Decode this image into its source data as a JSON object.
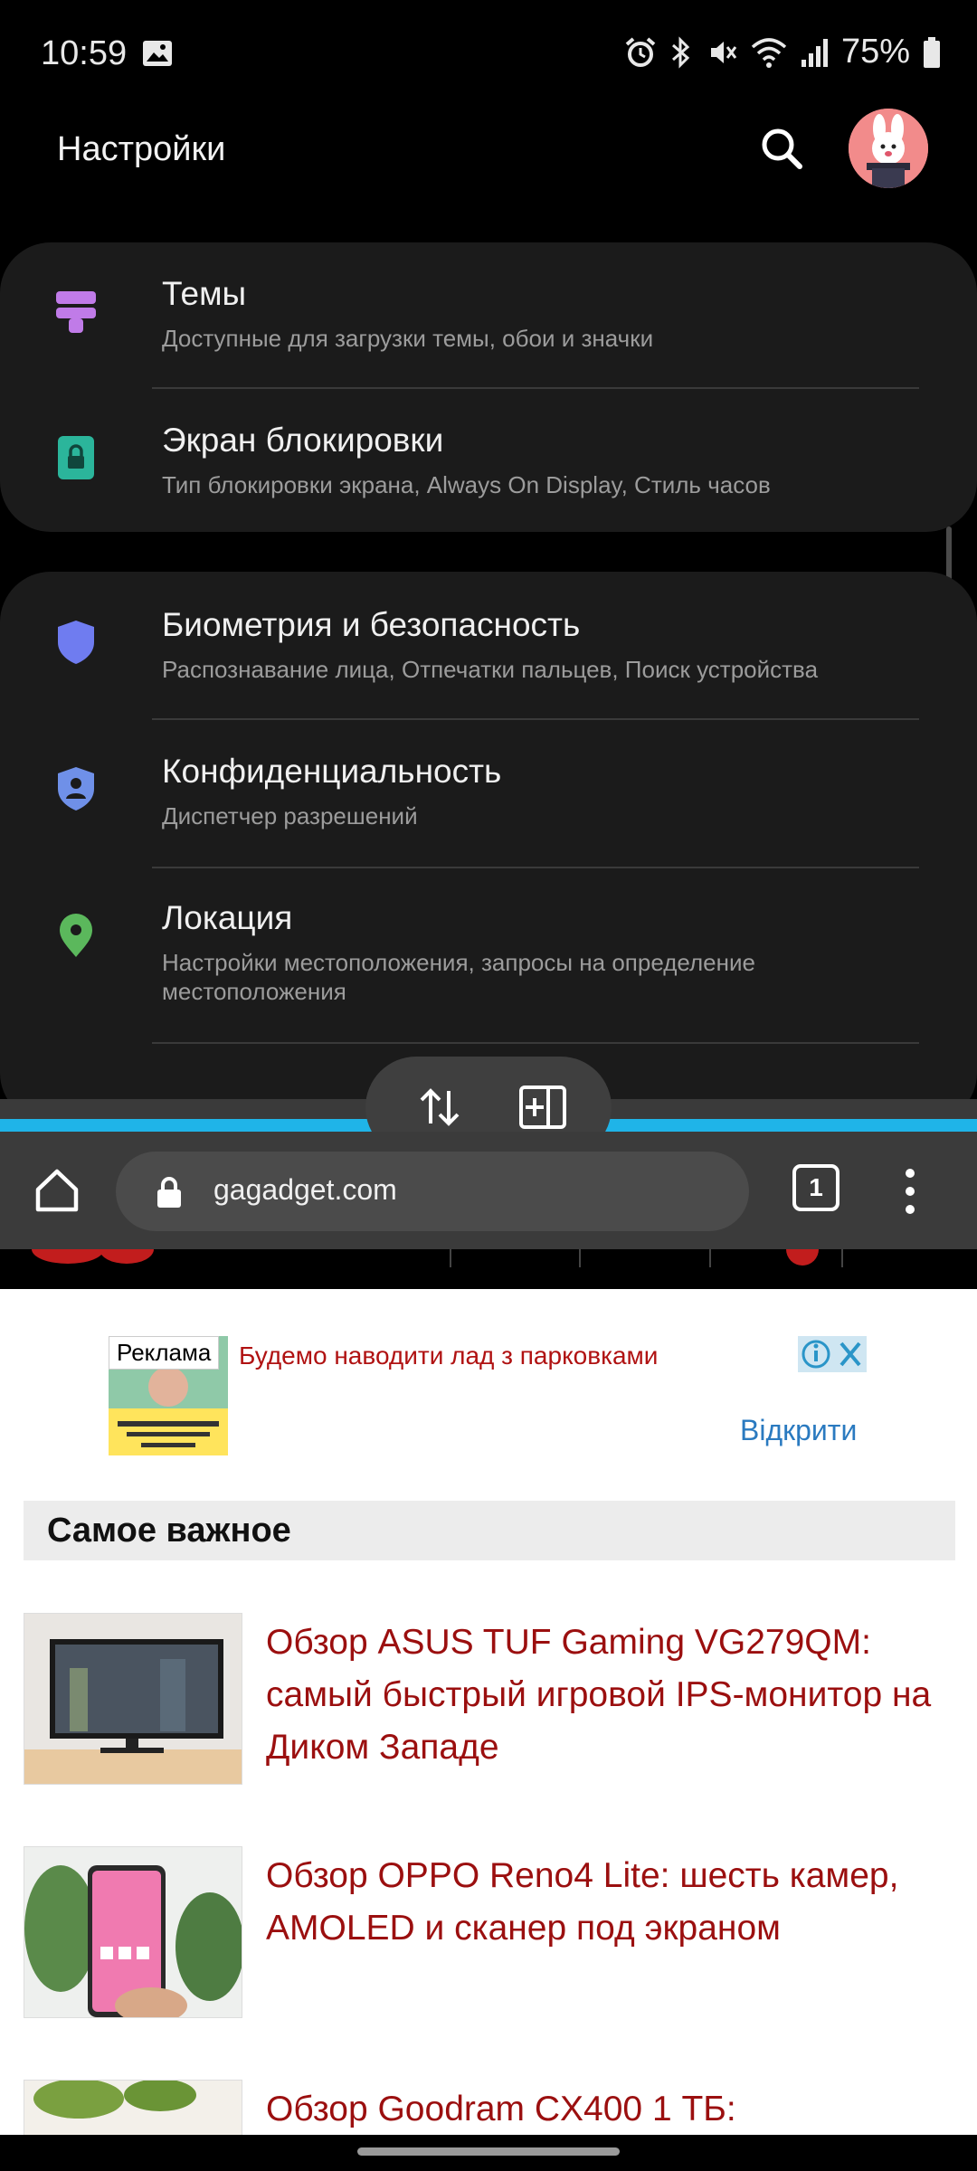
{
  "status_bar": {
    "time": "10:59",
    "battery": "75%",
    "icons": [
      "image-icon",
      "alarm-icon",
      "bluetooth-icon",
      "mute-icon",
      "wifi-icon",
      "signal-icon",
      "battery-icon"
    ]
  },
  "settings": {
    "title": "Настройки",
    "groups": [
      {
        "items": [
          {
            "title": "Темы",
            "subtitle": "Доступные для загрузки темы, обои и значки",
            "icon": "themes-icon",
            "color": "#c07be8"
          },
          {
            "title": "Экран блокировки",
            "subtitle": "Тип блокировки экрана, Always On Display, Стиль часов",
            "icon": "lock-screen-icon",
            "color": "#2bb59b"
          }
        ]
      },
      {
        "items": [
          {
            "title": "Биометрия и безопасность",
            "subtitle": "Распознавание лица, Отпечатки пальцев, Поиск устройства",
            "icon": "shield-icon",
            "color": "#6f7cf0"
          },
          {
            "title": "Конфиденциальность",
            "subtitle": "Диспетчер разрешений",
            "icon": "privacy-shield-icon",
            "color": "#6f90e8"
          },
          {
            "title": "Локация",
            "subtitle": "Настройки местоположения, запросы на определение местоположения",
            "icon": "location-pin-icon",
            "color": "#5bb85c"
          }
        ]
      }
    ]
  },
  "browser": {
    "url": "gagadget.com",
    "tab_count": "1"
  },
  "web": {
    "ad": {
      "label": "Реклама",
      "title": "Будемо наводити лад з парковками",
      "cta": "Відкрити"
    },
    "section_title": "Самое важное",
    "articles": [
      {
        "title": "Обзор ASUS TUF Gaming VG279QM: самый быстрый игровой IPS-монитор на Диком Западе"
      },
      {
        "title": "Обзор OPPO Reno4 Lite: шесть камер, AMOLED и сканер под экраном"
      },
      {
        "title": "Обзор Goodram CX400 1 ТБ:"
      }
    ]
  }
}
